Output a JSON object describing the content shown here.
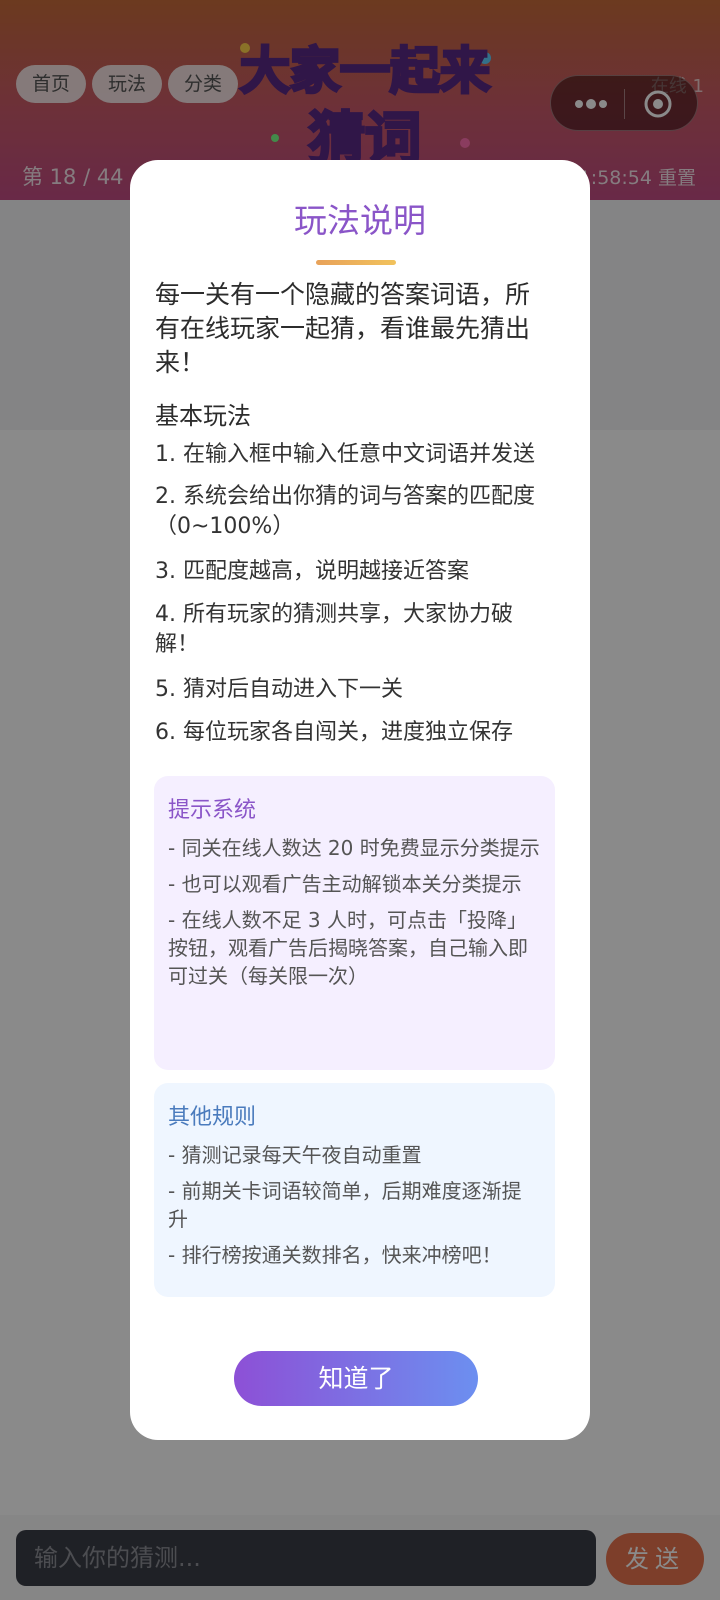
{
  "header": {
    "nav": [
      "首页",
      "玩法",
      "分类"
    ],
    "logo_line1": "大家一起来",
    "logo_line2": "猜词",
    "online": "在线 1",
    "level": "第 18 / 44",
    "timer": "1:58:54 重置"
  },
  "modal": {
    "title": "玩法说明",
    "intro": "每一关有一个隐藏的答案词语，所有在线玩家一起猜，看谁最先猜出来！",
    "basic_heading": "基本玩法",
    "rules": [
      "1. 在输入框中输入任意中文词语并发送",
      "2. 系统会给出你猜的词与答案的匹配度（0~100%）",
      "3. 匹配度越高，说明越接近答案",
      "4. 所有玩家的猜测共享，大家协力破解！",
      "5. 猜对后自动进入下一关",
      "6. 每位玩家各自闯关，进度独立保存"
    ],
    "hint_title": "提示系统",
    "hint_items": [
      "- 同关在线人数达 20 时免费显示分类提示",
      "- 也可以观看广告主动解锁本关分类提示",
      "- 在线人数不足 3 人时，可点击「投降」按钮，观看广告后揭晓答案，自己输入即可过关（每关限一次）"
    ],
    "other_title": "其他规则",
    "other_items": [
      "- 猜测记录每天午夜自动重置",
      "- 前期关卡词语较简单，后期难度逐渐提升",
      "- 排行榜按通关数排名，快来冲榜吧！"
    ],
    "ok_label": "知道了"
  },
  "input": {
    "placeholder": "输入你的猜测...",
    "send_label": "发送"
  },
  "icons": {
    "more": "more-dots-icon",
    "close": "target-close-icon"
  }
}
